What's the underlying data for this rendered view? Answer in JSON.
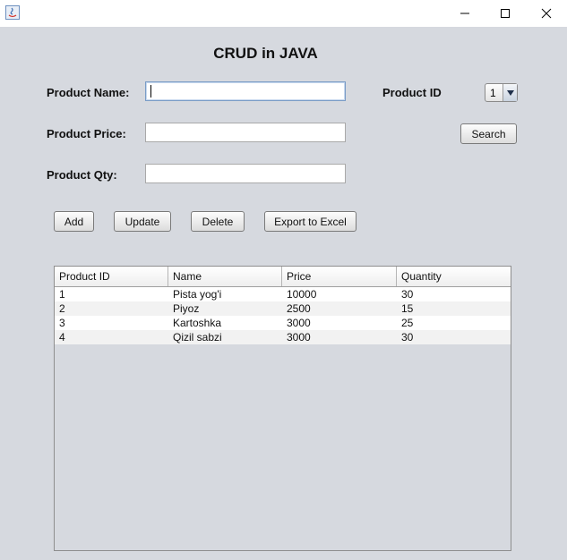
{
  "window": {
    "minimize_glyph": "—",
    "maximize_glyph": "☐",
    "close_glyph": "✕"
  },
  "form": {
    "heading": "CRUD in JAVA",
    "name_label": "Product Name:",
    "name_value": "",
    "price_label": "Product Price:",
    "price_value": "",
    "qty_label": "Product Qty:",
    "qty_value": "",
    "id_label": "Product ID",
    "id_selected": "1"
  },
  "buttons": {
    "add": "Add",
    "update": "Update",
    "delete": "Delete",
    "export": "Export to Excel",
    "search": "Search"
  },
  "table": {
    "columns": [
      "Product ID",
      "Name",
      "Price",
      "Quantity"
    ],
    "rows": [
      [
        "1",
        "Pista yog'i",
        "10000",
        "30"
      ],
      [
        "2",
        "Piyoz",
        "2500",
        "15"
      ],
      [
        "3",
        "Kartoshka",
        "3000",
        "25"
      ],
      [
        "4",
        "Qizil sabzi",
        "3000",
        "30"
      ]
    ]
  },
  "colors": {
    "panel_bg": "#d6d9df",
    "titlebar_bg": "#ffffff",
    "focus_border": "#7a9cc6"
  }
}
